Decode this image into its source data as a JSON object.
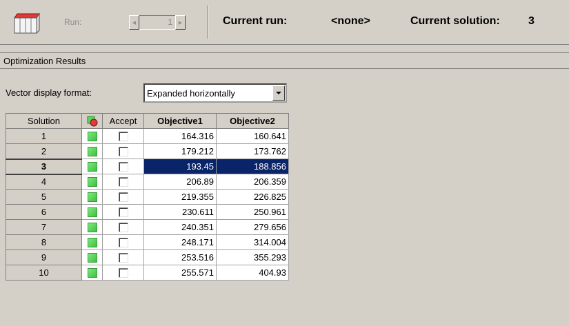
{
  "toolbar": {
    "run_label": "Run:",
    "run_value": "1",
    "current_run_label": "Current run:",
    "current_run_value": "<none>",
    "current_solution_label": "Current solution:",
    "current_solution_value": "3"
  },
  "section": {
    "title": "Optimization Results"
  },
  "format": {
    "label": "Vector display format:",
    "value": "Expanded horizontally"
  },
  "table": {
    "headers": [
      "Solution",
      "",
      "Accept",
      "Objective1",
      "Objective2"
    ],
    "selected_solution": "3",
    "rows": [
      {
        "solution": "1",
        "objective1": "164.316",
        "objective2": "160.641"
      },
      {
        "solution": "2",
        "objective1": "179.212",
        "objective2": "173.762"
      },
      {
        "solution": "3",
        "objective1": "193.45",
        "objective2": "188.856"
      },
      {
        "solution": "4",
        "objective1": "206.89",
        "objective2": "206.359"
      },
      {
        "solution": "5",
        "objective1": "219.355",
        "objective2": "226.825"
      },
      {
        "solution": "6",
        "objective1": "230.611",
        "objective2": "250.961"
      },
      {
        "solution": "7",
        "objective1": "240.351",
        "objective2": "279.656"
      },
      {
        "solution": "8",
        "objective1": "248.171",
        "objective2": "314.004"
      },
      {
        "solution": "9",
        "objective1": "253.516",
        "objective2": "355.293"
      },
      {
        "solution": "10",
        "objective1": "255.571",
        "objective2": "404.93"
      }
    ]
  },
  "colors": {
    "selection": "#0a246a",
    "status_green": "#5fd35f",
    "panel": "#d4d0c8"
  },
  "icons": {
    "toolbar": "run-cube-icon",
    "status_header": "status-marker-icon",
    "status_cell": "status-green-square-icon",
    "accept_cell": "checkbox-unchecked-icon"
  }
}
